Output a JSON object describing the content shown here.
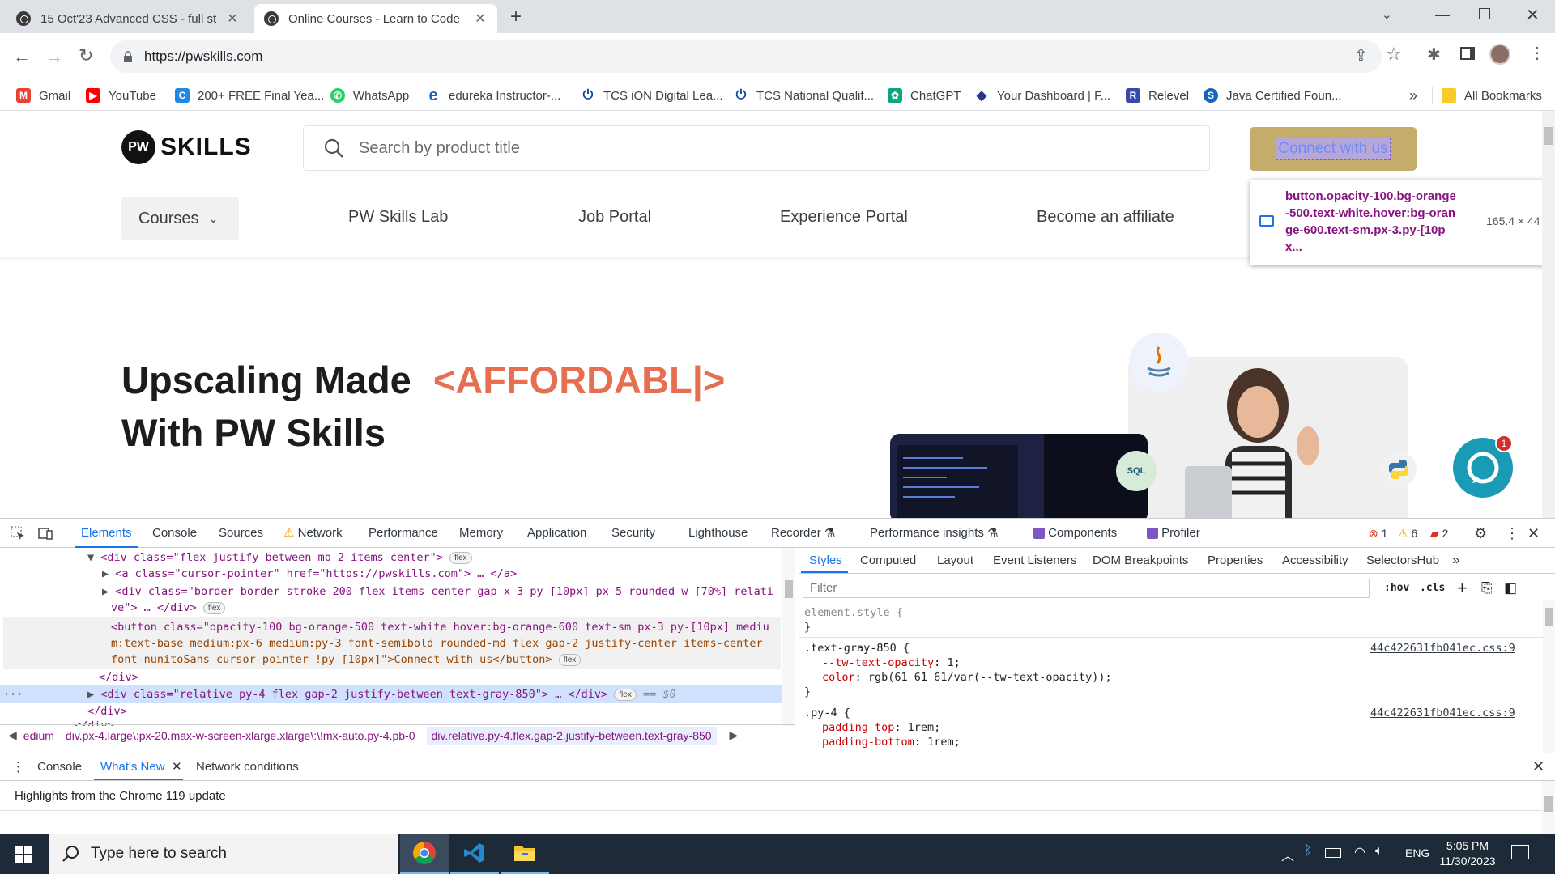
{
  "browser": {
    "tabs": [
      {
        "title": "15 Oct'23 Advanced CSS - full st",
        "active": false
      },
      {
        "title": "Online Courses - Learn to Code",
        "active": true
      }
    ],
    "new_tab": "+",
    "address": "https://pwskills.com",
    "bookmarks": [
      {
        "label": "Gmail",
        "icon": "gmail-icon",
        "color": "#ea4335"
      },
      {
        "label": "YouTube",
        "icon": "youtube-icon",
        "color": "#ff0000"
      },
      {
        "label": "200+ FREE Final Yea...",
        "icon": "c-icon",
        "color": "#1e88e5"
      },
      {
        "label": "WhatsApp",
        "icon": "whatsapp-icon",
        "color": "#25d366"
      },
      {
        "label": "edureka Instructor-...",
        "icon": "edureka-icon",
        "color": "#1565c0"
      },
      {
        "label": "TCS iON Digital Lea...",
        "icon": "tcs-icon",
        "color": "#0d47a1"
      },
      {
        "label": "TCS National Qualif...",
        "icon": "tcs-icon",
        "color": "#0d47a1"
      },
      {
        "label": "ChatGPT",
        "icon": "chatgpt-icon",
        "color": "#10a37f"
      },
      {
        "label": "Your Dashboard | F...",
        "icon": "dashboard-icon",
        "color": "#283593"
      },
      {
        "label": "Relevel",
        "icon": "relevel-icon",
        "color": "#3949ab"
      },
      {
        "label": "Java Certified Foun...",
        "icon": "java-icon",
        "color": "#1565c0"
      }
    ],
    "bookmarks_overflow": "»",
    "all_bookmarks": "All Bookmarks"
  },
  "page": {
    "logo_text": "SKILLS",
    "logo_letters": "PW",
    "search_placeholder": "Search by product title",
    "connect_button": "Connect with us",
    "nav": [
      "Courses",
      "PW Skills Lab",
      "Job Portal",
      "Experience Portal",
      "Become an affiliate"
    ],
    "tooltip_selector": "button.opacity-100.bg-orange-500.text-white.hover:bg-orange-600.text-sm.px-3.py-[10px...",
    "tooltip_size": "165.4 × 44",
    "hero_line1": "Upscaling Made",
    "hero_highlight": "<AFFORDABL|>",
    "hero_line2": "With PW Skills",
    "chat_badge": "1",
    "sql_badge": "SQL",
    "colors": {
      "accent": "#e76f51",
      "button": "#c4ac6b",
      "teal": "#1a9bb5"
    }
  },
  "devtools": {
    "tabs": [
      "Elements",
      "Console",
      "Sources",
      "Network",
      "Performance",
      "Memory",
      "Application",
      "Security",
      "Lighthouse",
      "Recorder",
      "Performance insights",
      "Components",
      "Profiler"
    ],
    "errors": "1",
    "warnings": "6",
    "issues": "2",
    "elements": [
      {
        "text": "<div class=\"flex justify-between mb-2 items-center\">",
        "badge": "flex"
      },
      {
        "text": "<a class=\"cursor-pointer\" href=\"https://pwskills.com\"> … </a>"
      },
      {
        "text": "<div class=\"border border-stroke-200 flex items-center gap-x-3 py-[10px] px-5 rounded w-[70%] relati"
      },
      {
        "text": "ve\"> … </div>",
        "badge": "flex"
      },
      {
        "text": "<button class=\"opacity-100 bg-orange-500 text-white hover:bg-orange-600 text-sm px-3 py-[10px] mediu"
      },
      {
        "text": "m:text-base medium:px-6 medium:py-3 font-semibold rounded-md flex gap-2 justify-center items-center"
      },
      {
        "text": "font-nunitoSans cursor-pointer !py-[10px]\">Connect with us</button>",
        "badge": "flex"
      },
      {
        "text": "</div>"
      },
      {
        "text": "<div class=\"relative py-4 flex gap-2 justify-between text-gray-850\"> … </div>",
        "badge": "flex",
        "suffix": "== $0"
      },
      {
        "text": "</div>"
      },
      {
        "text": "</div>"
      }
    ],
    "breadcrumbs": [
      "edium",
      "div.px-4.large\\:px-20.max-w-screen-xlarge.xlarge\\:\\!mx-auto.py-4.pb-0",
      "div.relative.py-4.flex.gap-2.justify-between.text-gray-850"
    ],
    "styles_tabs": [
      "Styles",
      "Computed",
      "Layout",
      "Event Listeners",
      "DOM Breakpoints",
      "Properties",
      "Accessibility",
      "SelectorsHub"
    ],
    "filter_placeholder": "Filter",
    "hov": ":hov",
    "cls": ".cls",
    "rules": [
      {
        "selector": "element.style {",
        "source": "",
        "props": [],
        "close": "}"
      },
      {
        "selector": ".text-gray-850 {",
        "source": "44c422631fb041ec.css:9",
        "props": [
          [
            "--tw-text-opacity",
            "1;"
          ],
          [
            "color",
            "rgb(61 61 61/var(--tw-text-opacity));"
          ]
        ],
        "close": "}"
      },
      {
        "selector": ".py-4 {",
        "source": "44c422631fb041ec.css:9",
        "props": [
          [
            "padding-top",
            "1rem;"
          ],
          [
            "padding-bottom",
            "1rem;"
          ]
        ],
        "close": ""
      }
    ]
  },
  "drawer": {
    "tabs": [
      "Console",
      "What's New",
      "Network conditions"
    ],
    "content": "Highlights from the Chrome 119 update"
  },
  "taskbar": {
    "search": "Type here to search",
    "lang": "ENG",
    "time": "5:05 PM",
    "date": "11/30/2023"
  }
}
